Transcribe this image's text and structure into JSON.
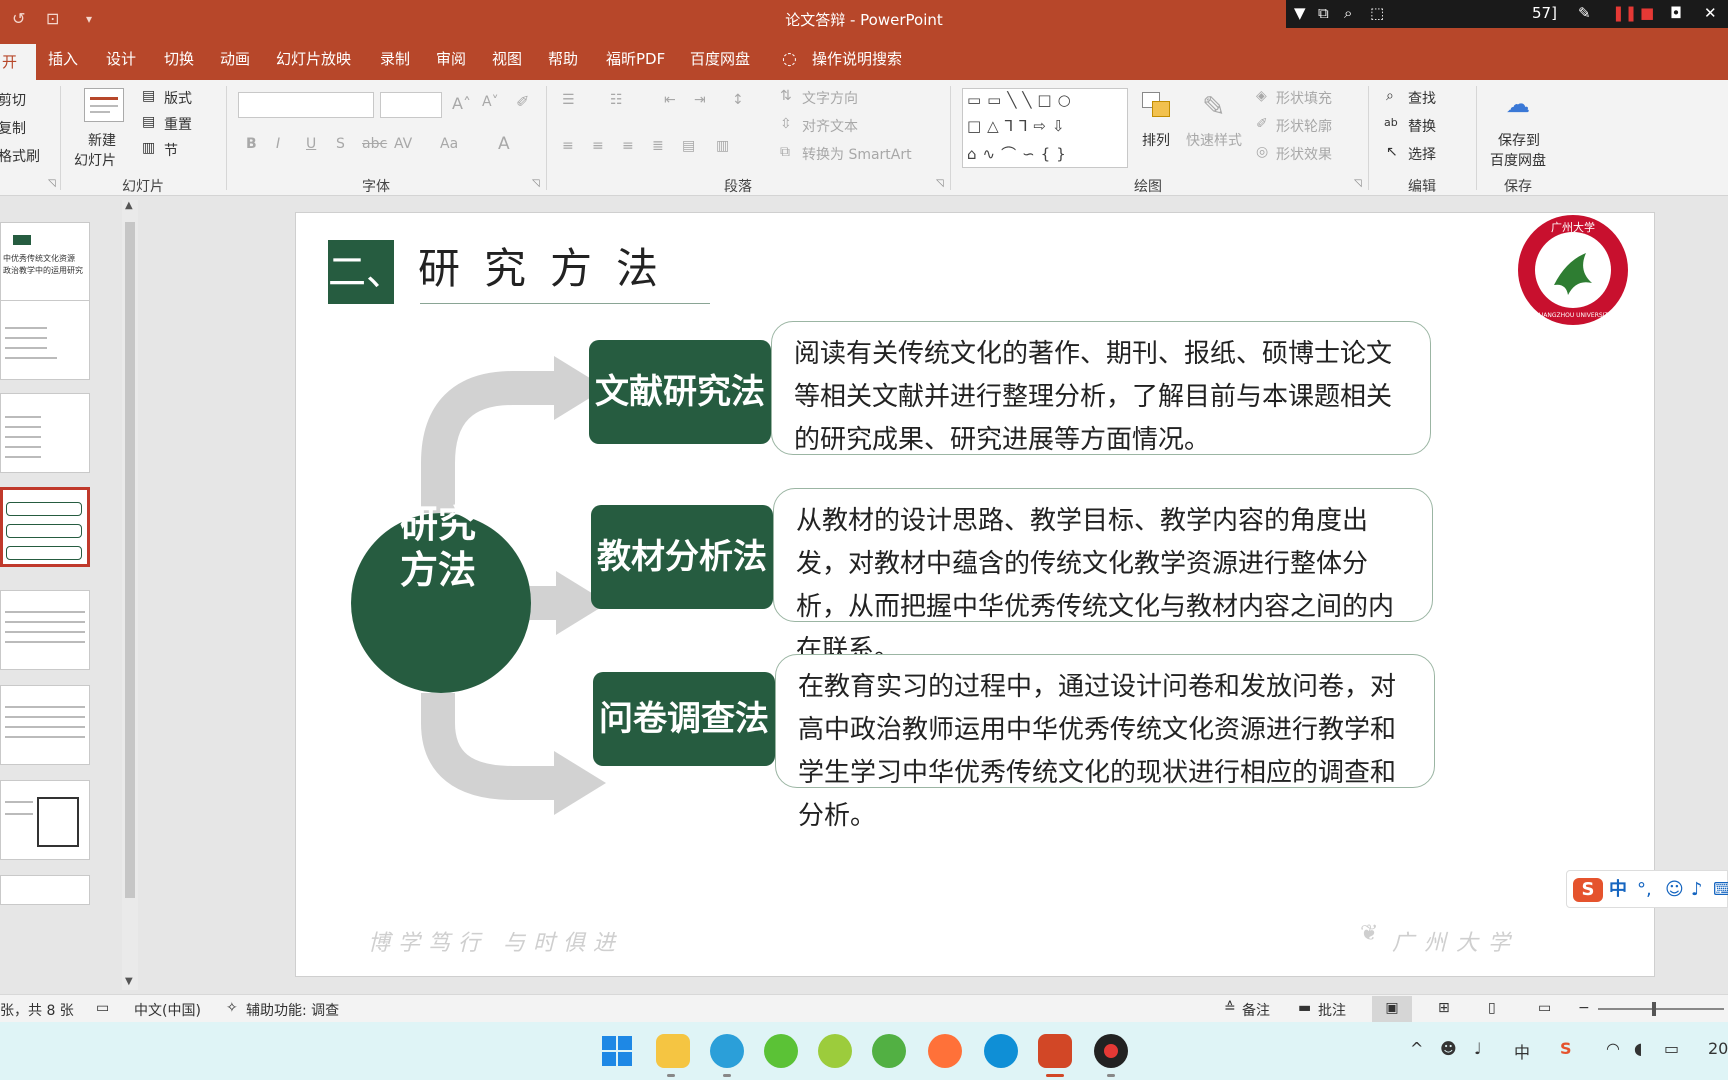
{
  "window": {
    "title": "论文答辩  -  PowerPoint",
    "recorder_fragment": "57]"
  },
  "tabs": [
    "开始",
    "插入",
    "设计",
    "切换",
    "动画",
    "幻灯片放映",
    "录制",
    "审阅",
    "视图",
    "帮助",
    "福昕PDF",
    "百度网盘"
  ],
  "tell_me": "操作说明搜索",
  "ribbon": {
    "clipboard": {
      "cut": "剪切",
      "copy": "复制",
      "format_painter": "格式刷"
    },
    "slides": {
      "new_slide_1": "新建",
      "new_slide_2": "幻灯片",
      "layout": "版式",
      "reset": "重置",
      "section": "节",
      "group": "幻灯片"
    },
    "font": {
      "group": "字体"
    },
    "paragraph": {
      "text_direction": "文字方向",
      "align_text": "对齐文本",
      "smartart": "转换为 SmartArt",
      "group": "段落"
    },
    "drawing": {
      "arrange": "排列",
      "quick_styles": "快速样式",
      "shape_fill": "形状填充",
      "shape_outline": "形状轮廓",
      "shape_effects": "形状效果",
      "group": "绘图"
    },
    "editing": {
      "find": "查找",
      "replace": "替换",
      "select": "选择",
      "group": "编辑"
    },
    "save": {
      "label_1": "保存到",
      "label_2": "百度网盘",
      "group": "保存"
    }
  },
  "slide": {
    "section_number": "二、",
    "section_title": "研究方法",
    "center_label_1": "研究",
    "center_label_2": "方法",
    "methods": [
      {
        "name": "文献研究法",
        "description": "阅读有关传统文化的著作、期刊、报纸、硕博士论文等相关文献并进行整理分析，了解目前与本课题相关的研究成果、研究进展等方面情况。"
      },
      {
        "name": "教材分析法",
        "description": "从教材的设计思路、教学目标、教学内容的角度出发，对教材中蕴含的传统文化教学资源进行整体分析，从而把握中华优秀传统文化与教材内容之间的内在联系。"
      },
      {
        "name": "问卷调查法",
        "description": "在教育实习的过程中，通过设计问卷和发放问卷，对高中政治教师运用中华优秀传统文化资源进行教学和学生学习中华优秀传统文化的现状进行相应的调查和分析。"
      }
    ],
    "motto": "博学笃行 与时俱进",
    "university_footer": "广州大学",
    "logo": {
      "text_top": "广州大学",
      "text_bottom": "GUANGZHOU UNIVERSITY"
    }
  },
  "thumbnails": {
    "first_title": "中优秀传统文化资源",
    "first_subtitle": "政治教学中的运用研究"
  },
  "ime": {
    "mode": "中"
  },
  "statusbar": {
    "slide_count": "张，共 8 张",
    "language": "中文(中国)",
    "accessibility": "辅助功能: 调查",
    "notes": "备注",
    "comments": "批注"
  },
  "taskbar": {
    "tray_lang": "中",
    "clock_fragment": "20"
  },
  "colors": {
    "accent": "#b7472a",
    "green": "#265c40",
    "university_red": "#c8102e"
  }
}
